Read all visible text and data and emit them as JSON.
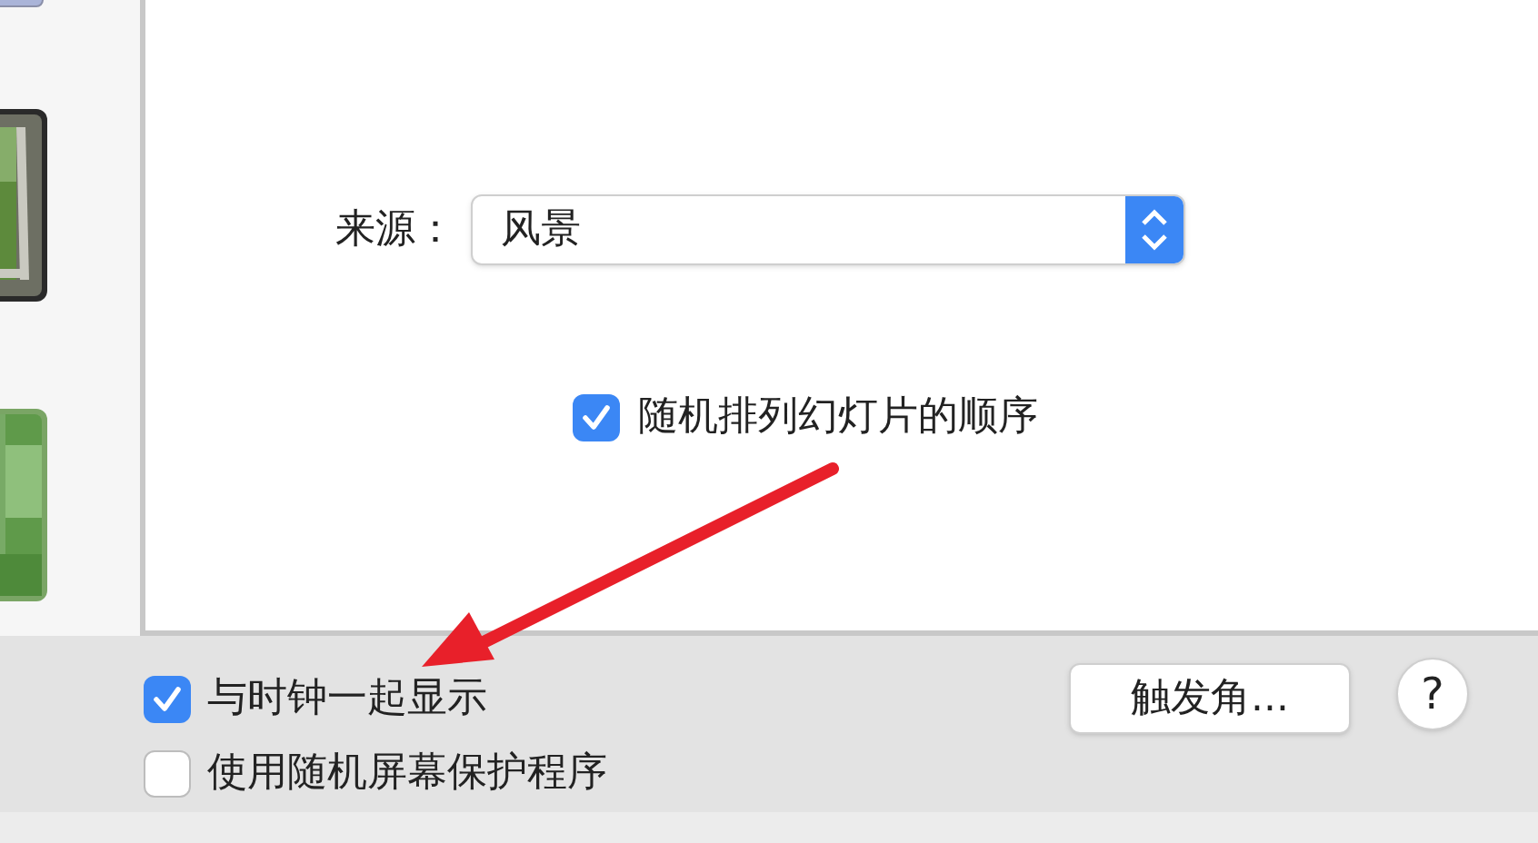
{
  "source": {
    "label": "来源：",
    "value": "风景"
  },
  "shuffle": {
    "label": "随机排列幻灯片的顺序",
    "checked": true
  },
  "options": [
    {
      "label": "与时钟一起显示",
      "checked": true
    },
    {
      "label": "使用随机屏幕保护程序",
      "checked": false
    }
  ],
  "hot_corners_button": "触发角...",
  "help_button": "?"
}
